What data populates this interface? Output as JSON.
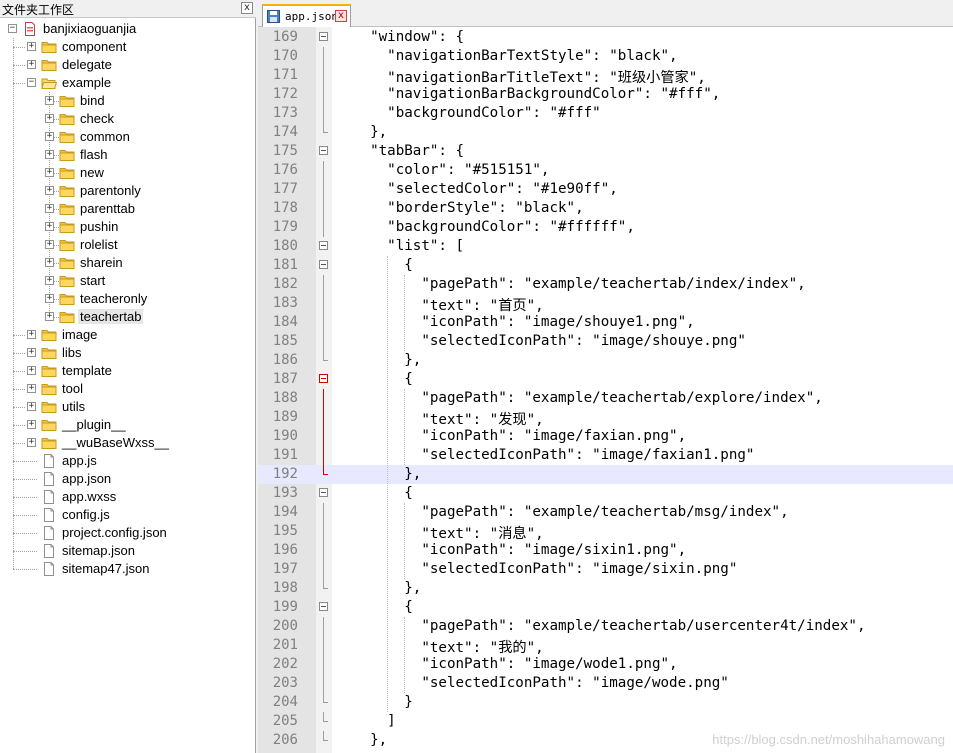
{
  "panel": {
    "title": "文件夹工作区",
    "close_label": "x"
  },
  "tree": [
    {
      "label": "banjixiaoguanjia",
      "depth": 0,
      "kind": "project",
      "expanded": true
    },
    {
      "label": "component",
      "depth": 1,
      "kind": "folder",
      "expanded": false
    },
    {
      "label": "delegate",
      "depth": 1,
      "kind": "folder",
      "expanded": false
    },
    {
      "label": "example",
      "depth": 1,
      "kind": "folder-open",
      "expanded": true
    },
    {
      "label": "bind",
      "depth": 2,
      "kind": "folder",
      "expanded": false
    },
    {
      "label": "check",
      "depth": 2,
      "kind": "folder",
      "expanded": false
    },
    {
      "label": "common",
      "depth": 2,
      "kind": "folder",
      "expanded": false
    },
    {
      "label": "flash",
      "depth": 2,
      "kind": "folder",
      "expanded": false
    },
    {
      "label": "new",
      "depth": 2,
      "kind": "folder",
      "expanded": false
    },
    {
      "label": "parentonly",
      "depth": 2,
      "kind": "folder",
      "expanded": false
    },
    {
      "label": "parenttab",
      "depth": 2,
      "kind": "folder",
      "expanded": false
    },
    {
      "label": "pushin",
      "depth": 2,
      "kind": "folder",
      "expanded": false
    },
    {
      "label": "rolelist",
      "depth": 2,
      "kind": "folder",
      "expanded": false
    },
    {
      "label": "sharein",
      "depth": 2,
      "kind": "folder",
      "expanded": false
    },
    {
      "label": "start",
      "depth": 2,
      "kind": "folder",
      "expanded": false
    },
    {
      "label": "teacheronly",
      "depth": 2,
      "kind": "folder",
      "expanded": false
    },
    {
      "label": "teachertab",
      "depth": 2,
      "kind": "folder",
      "expanded": false,
      "selected": true
    },
    {
      "label": "image",
      "depth": 1,
      "kind": "folder",
      "expanded": false
    },
    {
      "label": "libs",
      "depth": 1,
      "kind": "folder",
      "expanded": false
    },
    {
      "label": "template",
      "depth": 1,
      "kind": "folder",
      "expanded": false
    },
    {
      "label": "tool",
      "depth": 1,
      "kind": "folder",
      "expanded": false
    },
    {
      "label": "utils",
      "depth": 1,
      "kind": "folder",
      "expanded": false
    },
    {
      "label": "__plugin__",
      "depth": 1,
      "kind": "folder",
      "expanded": false
    },
    {
      "label": "__wuBaseWxss__",
      "depth": 1,
      "kind": "folder",
      "expanded": false
    },
    {
      "label": "app.js",
      "depth": 1,
      "kind": "file"
    },
    {
      "label": "app.json",
      "depth": 1,
      "kind": "file"
    },
    {
      "label": "app.wxss",
      "depth": 1,
      "kind": "file"
    },
    {
      "label": "config.js",
      "depth": 1,
      "kind": "file"
    },
    {
      "label": "project.config.json",
      "depth": 1,
      "kind": "file"
    },
    {
      "label": "sitemap.json",
      "depth": 1,
      "kind": "file"
    },
    {
      "label": "sitemap47.json",
      "depth": 1,
      "kind": "file"
    }
  ],
  "editor": {
    "tab_label": "app.json",
    "tab_close_label": "x",
    "current_line": 192,
    "lines": [
      {
        "num": "169",
        "text": "  \"window\": {",
        "fold": "box"
      },
      {
        "num": "170",
        "text": "    \"navigationBarTextStyle\": \"black\",",
        "fold": "line"
      },
      {
        "num": "171",
        "text": "    \"navigationBarTitleText\": \"班级小管家\",",
        "fold": "line"
      },
      {
        "num": "172",
        "text": "    \"navigationBarBackgroundColor\": \"#fff\",",
        "fold": "line"
      },
      {
        "num": "173",
        "text": "    \"backgroundColor\": \"#fff\"",
        "fold": "line"
      },
      {
        "num": "174",
        "text": "  },",
        "fold": "end"
      },
      {
        "num": "175",
        "text": "  \"tabBar\": {",
        "fold": "box"
      },
      {
        "num": "176",
        "text": "    \"color\": \"#515151\",",
        "fold": "line"
      },
      {
        "num": "177",
        "text": "    \"selectedColor\": \"#1e90ff\",",
        "fold": "line"
      },
      {
        "num": "178",
        "text": "    \"borderStyle\": \"black\",",
        "fold": "line"
      },
      {
        "num": "179",
        "text": "    \"backgroundColor\": \"#ffffff\",",
        "fold": "line"
      },
      {
        "num": "180",
        "text": "    \"list\": [",
        "fold": "box"
      },
      {
        "num": "181",
        "text": "      {",
        "fold": "box"
      },
      {
        "num": "182",
        "text": "        \"pagePath\": \"example/teachertab/index/index\",",
        "fold": "line"
      },
      {
        "num": "183",
        "text": "        \"text\": \"首页\",",
        "fold": "line"
      },
      {
        "num": "184",
        "text": "        \"iconPath\": \"image/shouye1.png\",",
        "fold": "line"
      },
      {
        "num": "185",
        "text": "        \"selectedIconPath\": \"image/shouye.png\"",
        "fold": "line"
      },
      {
        "num": "186",
        "text": "      },",
        "fold": "end"
      },
      {
        "num": "187",
        "text": "      {",
        "fold": "box-red"
      },
      {
        "num": "188",
        "text": "        \"pagePath\": \"example/teachertab/explore/index\",",
        "fold": "line-red"
      },
      {
        "num": "189",
        "text": "        \"text\": \"发现\",",
        "fold": "line-red"
      },
      {
        "num": "190",
        "text": "        \"iconPath\": \"image/faxian.png\",",
        "fold": "line-red"
      },
      {
        "num": "191",
        "text": "        \"selectedIconPath\": \"image/faxian1.png\"",
        "fold": "line-red"
      },
      {
        "num": "192",
        "text": "      },",
        "fold": "end-red"
      },
      {
        "num": "193",
        "text": "      {",
        "fold": "box"
      },
      {
        "num": "194",
        "text": "        \"pagePath\": \"example/teachertab/msg/index\",",
        "fold": "line"
      },
      {
        "num": "195",
        "text": "        \"text\": \"消息\",",
        "fold": "line"
      },
      {
        "num": "196",
        "text": "        \"iconPath\": \"image/sixin1.png\",",
        "fold": "line"
      },
      {
        "num": "197",
        "text": "        \"selectedIconPath\": \"image/sixin.png\"",
        "fold": "line"
      },
      {
        "num": "198",
        "text": "      },",
        "fold": "end"
      },
      {
        "num": "199",
        "text": "      {",
        "fold": "box"
      },
      {
        "num": "200",
        "text": "        \"pagePath\": \"example/teachertab/usercenter4t/index\",",
        "fold": "line"
      },
      {
        "num": "201",
        "text": "        \"text\": \"我的\",",
        "fold": "line"
      },
      {
        "num": "202",
        "text": "        \"iconPath\": \"image/wode1.png\",",
        "fold": "line"
      },
      {
        "num": "203",
        "text": "        \"selectedIconPath\": \"image/wode.png\"",
        "fold": "line"
      },
      {
        "num": "204",
        "text": "      }",
        "fold": "end"
      },
      {
        "num": "205",
        "text": "    ]",
        "fold": "end"
      },
      {
        "num": "206",
        "text": "  },",
        "fold": "end"
      }
    ]
  },
  "watermark": "https://blog.csdn.net/moshihahamowang",
  "colors": {
    "folder": "#f5c542",
    "folder_edge": "#c89a1a",
    "fold_red": "#d00000",
    "current_line": "#e8e8ff",
    "string": "#000000"
  }
}
